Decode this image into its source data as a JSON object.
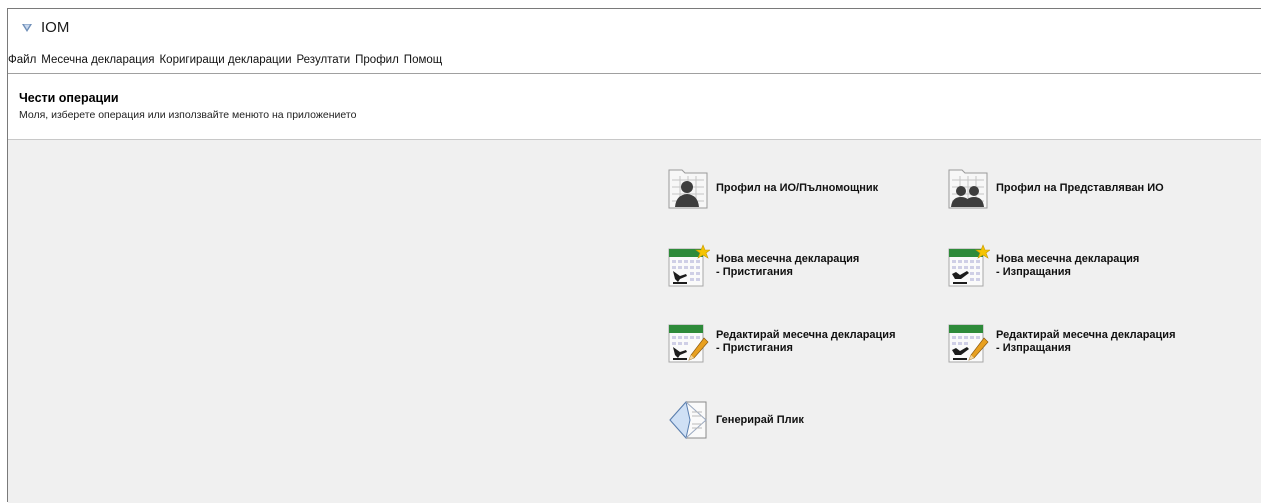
{
  "window": {
    "title": "IOM"
  },
  "menu": {
    "items": [
      "Файл",
      "Месечна декларация",
      "Коригиращи декларации",
      "Резултати",
      "Профил",
      "Помощ"
    ]
  },
  "header": {
    "title": "Чести операции",
    "subtitle": "Моля, изберете операция или използвайте менюто на приложението"
  },
  "operations": {
    "profile_io": {
      "line1": "Профил на ИО/Пълномощник",
      "line2": ""
    },
    "profile_represented": {
      "line1": "Профил на Представляван ИО",
      "line2": ""
    },
    "new_arrivals": {
      "line1": "Нова месечна декларация",
      "line2": "- Пристигания"
    },
    "new_dispatches": {
      "line1": "Нова месечна декларация",
      "line2": "- Изпращания"
    },
    "edit_arrivals": {
      "line1": "Редактирай месечна декларация",
      "line2": "- Пристигания"
    },
    "edit_dispatches": {
      "line1": "Редактирай месечна декларация",
      "line2": "- Изпращания"
    },
    "generate_envelope": {
      "line1": "Генерирай Плик",
      "line2": ""
    }
  },
  "icons": {
    "app": "chevron-down-icon",
    "profile_io": "person-card-icon",
    "profile_represented": "people-card-icon",
    "new_arrivals": "calendar-arrival-star-icon",
    "new_dispatches": "calendar-departure-star-icon",
    "edit_arrivals": "calendar-arrival-pencil-icon",
    "edit_dispatches": "calendar-departure-pencil-icon",
    "generate_envelope": "envelope-icon"
  },
  "colors": {
    "accent_green": "#2e8b3a",
    "star": "#f5c400",
    "background": "#f0f0f0"
  }
}
